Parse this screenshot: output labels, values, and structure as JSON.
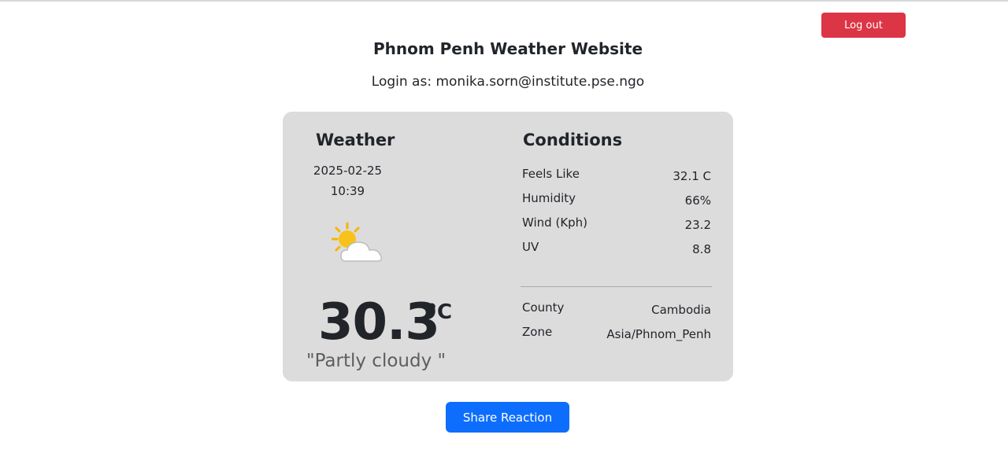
{
  "header": {
    "logout_label": "Log out",
    "title": "Phnom Penh Weather Website",
    "login_text": "Login as: monika.sorn@institute.pse.ngo"
  },
  "weather": {
    "heading": "Weather",
    "date": "2025-02-25",
    "time": "10:39",
    "icon": "partly-cloudy-icon",
    "temperature": "30.3",
    "unit": "°C",
    "condition": "\"Partly cloudy \""
  },
  "conditions": {
    "heading": "Conditions",
    "rows": [
      {
        "label": "Feels Like",
        "value": "32.1 C"
      },
      {
        "label": "Humidity",
        "value": "66%"
      },
      {
        "label": "Wind (Kph)",
        "value": "23.2"
      },
      {
        "label": "UV",
        "value": "8.8"
      }
    ],
    "location": [
      {
        "label": "County",
        "value": "Cambodia"
      },
      {
        "label": "Zone",
        "value": "Asia/Phnom_Penh"
      }
    ]
  },
  "actions": {
    "share_label": "Share Reaction"
  },
  "colors": {
    "logout": "#dc3545",
    "share": "#0d6efd",
    "card": "#dddcdd"
  }
}
